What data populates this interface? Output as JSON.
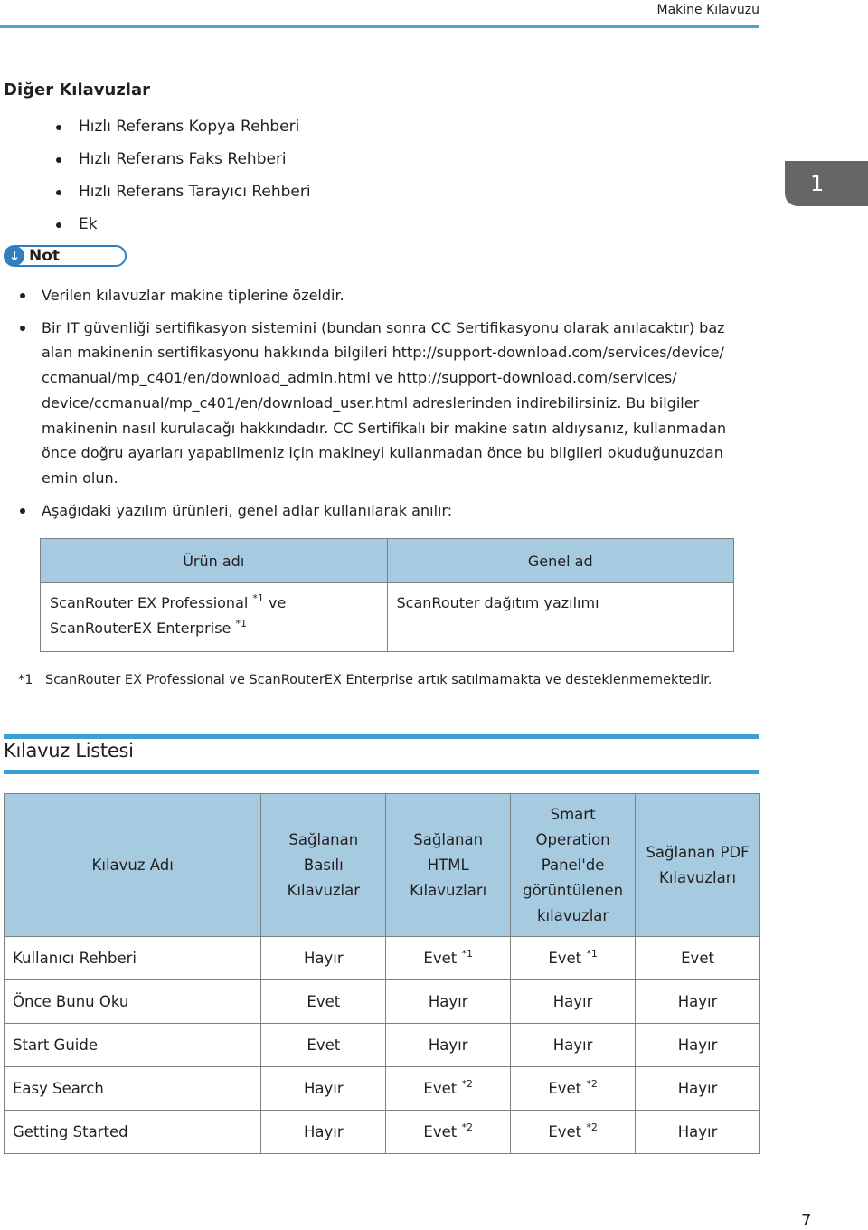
{
  "header": {
    "running_title": "Makine Kılavuzu"
  },
  "chapter_tab": "1",
  "other_guides": {
    "title": "Diğer Kılavuzlar",
    "items": [
      "Hızlı Referans Kopya Rehberi",
      "Hızlı Referans Faks Rehberi",
      "Hızlı Referans Tarayıcı Rehberi",
      "Ek"
    ]
  },
  "note": {
    "icon": "arrow-down-icon",
    "label": "Not",
    "colors": {
      "accent": "#2f7fc1"
    },
    "items": [
      "Verilen kılavuzlar makine tiplerine özeldir.",
      "Bir IT güvenliği sertifikasyon sistemini (bundan sonra CC Sertifikasyonu olarak anılacaktır) baz alan makinenin sertifikasyonu hakkında bilgileri http://support-download.com/services/device/ ccmanual/mp_c401/en/download_admin.html ve http://support-download.com/services/ device/ccmanual/mp_c401/en/download_user.html adreslerinden indirebilirsiniz. Bu bilgiler makinenin nasıl kurulacağı hakkındadır. CC Sertifikalı bir makine satın aldıysanız, kullanmadan önce doğru ayarları yapabilmeniz için makineyi kullanmadan önce bu bilgileri okuduğunuzdan emin olun.",
      "Aşağıdaki yazılım ürünleri, genel adlar kullanılarak anılır:"
    ]
  },
  "software_table": {
    "headers": [
      "Ürün adı",
      "Genel ad"
    ],
    "rows": [
      {
        "product_line1": "ScanRouter EX Professional",
        "product_line1_sup": "*1",
        "product_line1_suffix": "ve",
        "product_line2": "ScanRouterEX Enterprise",
        "product_line2_sup": "*1",
        "generic": "ScanRouter dağıtım yazılımı"
      }
    ]
  },
  "footnote": {
    "mark": "*1",
    "text": "ScanRouter EX Professional ve ScanRouterEX Enterprise artık satılmamakta ve desteklenmemektedir."
  },
  "guide_list": {
    "title": "Kılavuz Listesi",
    "headers": [
      "Kılavuz Adı",
      "Sağlanan Basılı Kılavuzlar",
      "Sağlanan HTML Kılavuzları",
      "Smart Operation Panel'de görüntülenen kılavuzlar",
      "Sağlanan PDF Kılavuzları"
    ],
    "rows": [
      {
        "name": "Kullanıcı Rehberi",
        "cells": [
          {
            "v": "Hayır",
            "sup": ""
          },
          {
            "v": "Evet",
            "sup": "*1"
          },
          {
            "v": "Evet",
            "sup": "*1"
          },
          {
            "v": "Evet",
            "sup": ""
          }
        ]
      },
      {
        "name": "Önce Bunu Oku",
        "cells": [
          {
            "v": "Evet",
            "sup": ""
          },
          {
            "v": "Hayır",
            "sup": ""
          },
          {
            "v": "Hayır",
            "sup": ""
          },
          {
            "v": "Hayır",
            "sup": ""
          }
        ]
      },
      {
        "name": "Start Guide",
        "cells": [
          {
            "v": "Evet",
            "sup": ""
          },
          {
            "v": "Hayır",
            "sup": ""
          },
          {
            "v": "Hayır",
            "sup": ""
          },
          {
            "v": "Hayır",
            "sup": ""
          }
        ]
      },
      {
        "name": "Easy Search",
        "cells": [
          {
            "v": "Hayır",
            "sup": ""
          },
          {
            "v": "Evet",
            "sup": "*2"
          },
          {
            "v": "Evet",
            "sup": "*2"
          },
          {
            "v": "Hayır",
            "sup": ""
          }
        ]
      },
      {
        "name": "Getting Started",
        "cells": [
          {
            "v": "Hayır",
            "sup": ""
          },
          {
            "v": "Evet",
            "sup": "*2"
          },
          {
            "v": "Evet",
            "sup": "*2"
          },
          {
            "v": "Hayır",
            "sup": ""
          }
        ]
      }
    ]
  },
  "colors": {
    "header_rule": "#4aa3d2",
    "table_header_bg": "#a6cadf",
    "chapter_tab_bg": "#666666"
  },
  "page_number": "7"
}
